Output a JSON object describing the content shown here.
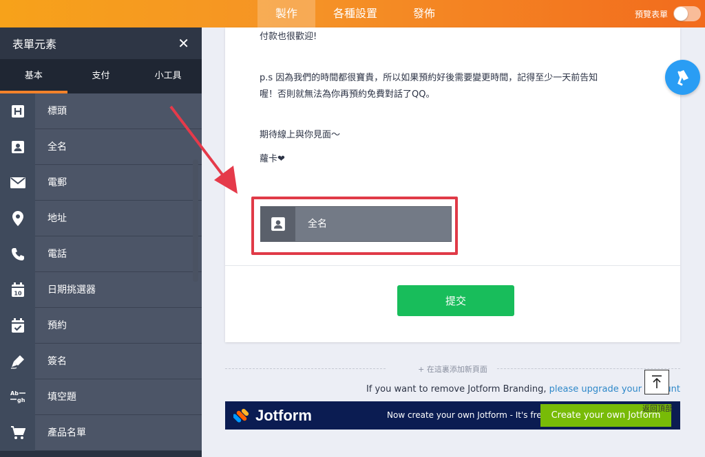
{
  "topbar": {
    "tabs": [
      {
        "label": "製作",
        "active": true
      },
      {
        "label": "各種設置",
        "active": false
      },
      {
        "label": "發佈",
        "active": false
      }
    ],
    "preview_label": "預覽表單",
    "preview_on": false
  },
  "sidebar": {
    "title": "表單元素",
    "tabs": [
      {
        "label": "基本",
        "active": true
      },
      {
        "label": "支付",
        "active": false
      },
      {
        "label": "小工具",
        "active": false
      }
    ],
    "items": [
      {
        "label": "標頭",
        "icon": "heading-icon"
      },
      {
        "label": "全名",
        "icon": "contact-card-icon"
      },
      {
        "label": "電郵",
        "icon": "envelope-icon"
      },
      {
        "label": "地址",
        "icon": "map-pin-icon"
      },
      {
        "label": "電話",
        "icon": "phone-icon"
      },
      {
        "label": "日期挑選器",
        "icon": "calendar-icon"
      },
      {
        "label": "預約",
        "icon": "calendar-check-icon"
      },
      {
        "label": "簽名",
        "icon": "pen-icon"
      },
      {
        "label": "填空題",
        "icon": "fill-blank-icon"
      },
      {
        "label": "產品名單",
        "icon": "cart-icon"
      }
    ]
  },
  "form": {
    "paragraphs": [
      "付款也很歡迎!",
      "p.s 因為我們的時間都很寶貴，所以如果預約好後需要變更時間，記得至少一天前告知",
      "喔！否則就無法為你再預約免費對話了QQ。",
      "期待線上與你見面～",
      "蘿卡❤"
    ],
    "dropped_field_label": "全名",
    "submit_label": "提交"
  },
  "add_page_label": "+ 在這裏添加新頁面",
  "branding": {
    "text": "If you want to remove Jotform Branding, ",
    "link": "please upgrade your account"
  },
  "footer": {
    "logo_text": "Jotform",
    "message": "Now create your own Jotform - It's free!",
    "button": "Create your own Jotform"
  },
  "back_to_top": "返回頂部",
  "colors": {
    "accent_orange": "#f59226",
    "sidebar_bg": "#293241",
    "submit_green": "#18bd5b",
    "highlight_red": "#e03a47",
    "footer_navy": "#0b1c52",
    "cta_green": "#78bb07",
    "link_blue": "#2e88c9",
    "fab_blue": "#2a9df4"
  }
}
